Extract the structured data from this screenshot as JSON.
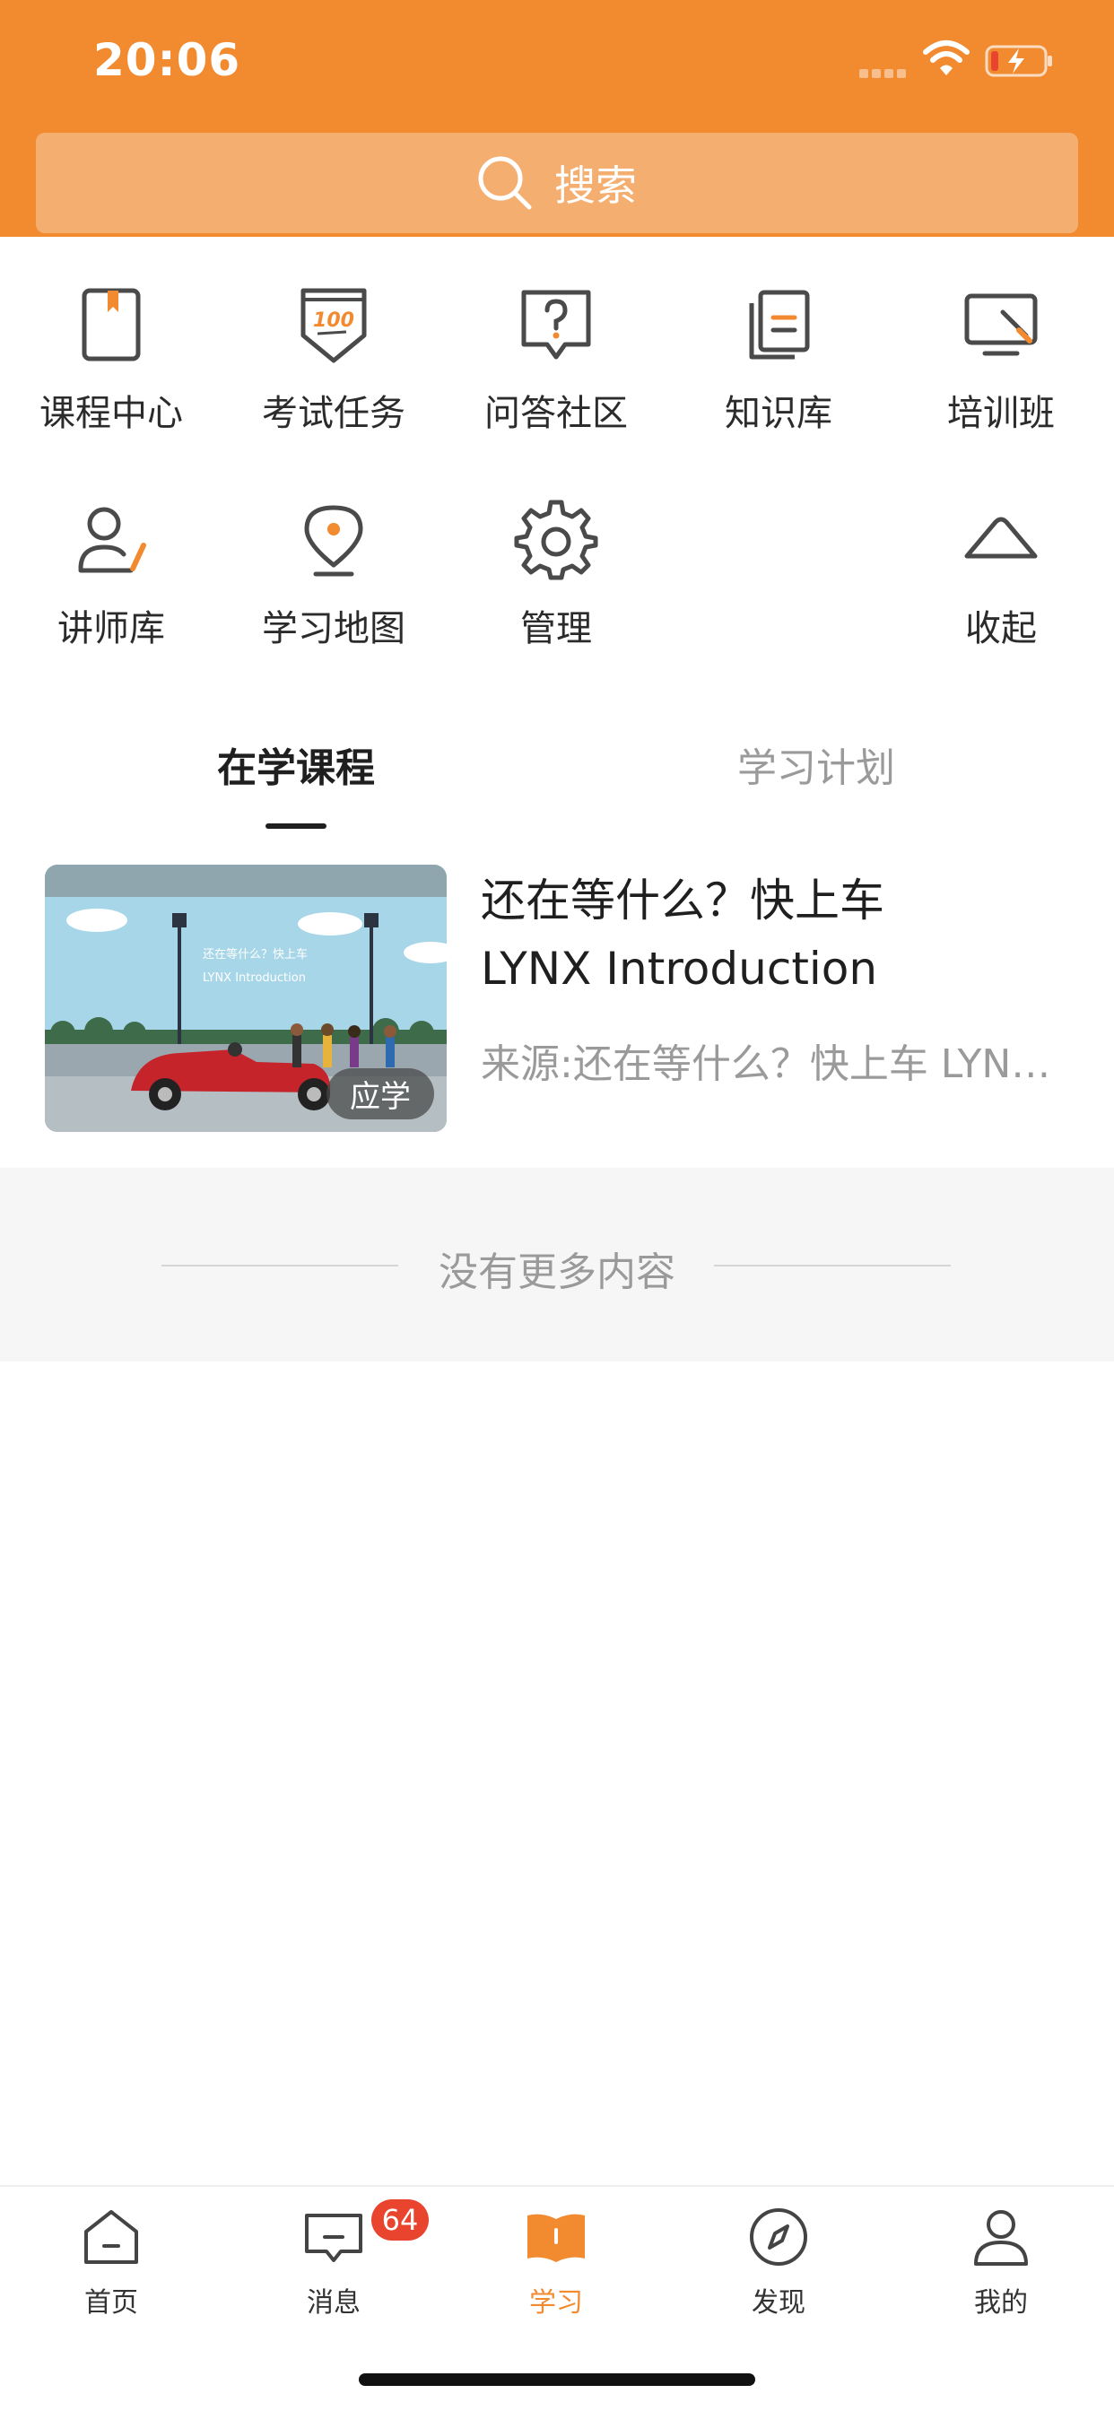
{
  "status": {
    "time": "20:06"
  },
  "search": {
    "label": "搜索"
  },
  "colors": {
    "accent": "#F28A30",
    "badge": "#E8442E"
  },
  "menu": [
    {
      "label": "课程中心",
      "icon": "bookmark-book-icon"
    },
    {
      "label": "考试任务",
      "icon": "exam-100-icon"
    },
    {
      "label": "问答社区",
      "icon": "question-bubble-icon"
    },
    {
      "label": "知识库",
      "icon": "knowledge-doc-icon"
    },
    {
      "label": "培训班",
      "icon": "training-screen-icon"
    },
    {
      "label": "讲师库",
      "icon": "lecturer-icon"
    },
    {
      "label": "学习地图",
      "icon": "map-pin-icon"
    },
    {
      "label": "管理",
      "icon": "gear-icon"
    },
    {
      "label": "收起",
      "icon": "chevron-up-icon"
    }
  ],
  "tabs": [
    {
      "label": "在学课程",
      "active": true
    },
    {
      "label": "学习计划",
      "active": false
    }
  ],
  "course": {
    "title_line1": "还在等什么？快上车",
    "title_line2": "LYNX Introduction",
    "source": "来源:还在等什么？快上车 LYNX Introduction",
    "badge": "应学",
    "thumb_caption1": "还在等什么？快上车",
    "thumb_caption2": "LYNX Introduction"
  },
  "footer_note": "没有更多内容",
  "bottom_nav": [
    {
      "label": "首页",
      "icon": "home-icon",
      "active": false
    },
    {
      "label": "消息",
      "icon": "message-icon",
      "active": false,
      "badge": "64"
    },
    {
      "label": "学习",
      "icon": "book-icon",
      "active": true
    },
    {
      "label": "发现",
      "icon": "compass-icon",
      "active": false
    },
    {
      "label": "我的",
      "icon": "profile-icon",
      "active": false
    }
  ]
}
